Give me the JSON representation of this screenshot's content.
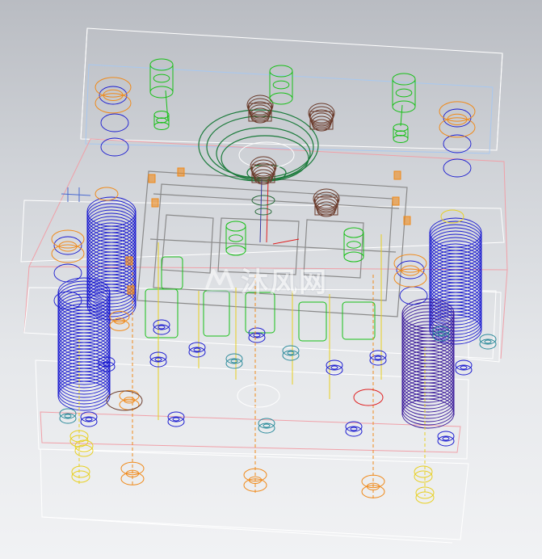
{
  "scene": {
    "kind": "3d-wireframe-cad-assembly",
    "background_top": "#b9bcc2",
    "background_bottom": "#f1f2f4"
  },
  "palette": {
    "plate_edge": "#ffffff",
    "plate_edge_pink": "#f0a0a8",
    "plate_edge_blue": "#a8c8f0",
    "spring": "#1a1ad0",
    "spring_dark": "#3a1a9a",
    "guide_orange": "#f08a1a",
    "green_part": "#18c018",
    "dark_green": "#1a7a3a",
    "gray_frame": "#8a8a8a",
    "brown_part": "#6a3a2a",
    "yellow_part": "#e8d020",
    "teal_part": "#2a8a9a",
    "red_line": "#e02020"
  },
  "watermark": {
    "text": "沐风网",
    "icon": "mufeng-logo-icon"
  }
}
